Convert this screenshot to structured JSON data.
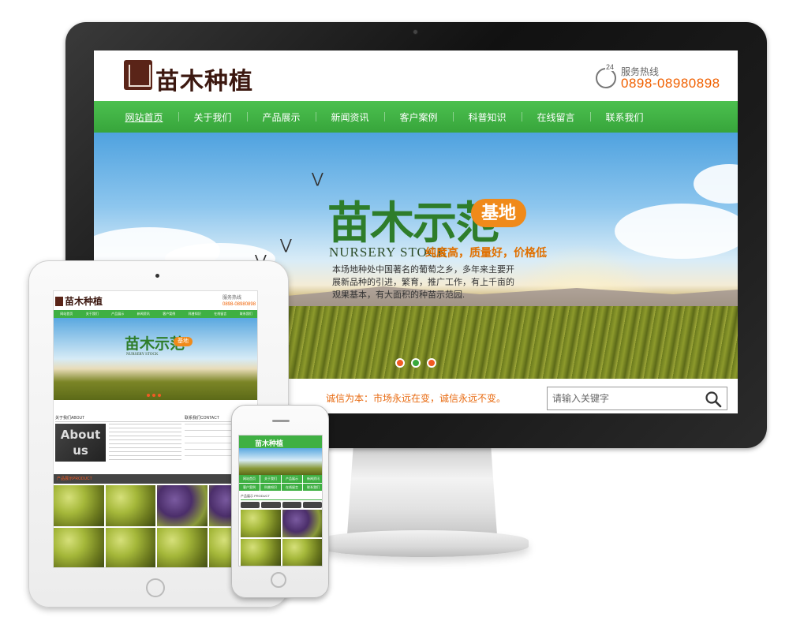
{
  "monitor": {
    "logo_text": "苗木种植",
    "hotline_label": "服务热线",
    "hotline_icon_text": "24",
    "hotline_number": "0898-08980898",
    "nav": [
      "网站首页",
      "关于我们",
      "产品展示",
      "新闻资讯",
      "客户案例",
      "科普知识",
      "在线留言",
      "联系我们"
    ],
    "banner": {
      "title": "苗木示范",
      "badge": "基地",
      "english": "NURSERY STOCK",
      "slogan": "纯度高，质量好，价格低",
      "description": "本场地种处中国著名的葡萄之乡，多年来主要开展新品种的引进，繁育，推广工作，有上千亩的观果基本，有大面积的种苗示范园.",
      "active_slide": 1,
      "slide_count": 3
    },
    "notice": "诚信为本：市场永远在变，诚信永远不变。",
    "search": {
      "placeholder": "请输入关键字"
    }
  },
  "tablet": {
    "logo_text": "苗木种植",
    "hotline_label": "服务热线",
    "hotline_number": "0898-08980898",
    "nav": [
      "网站首页",
      "关于我们",
      "产品展示",
      "新闻资讯",
      "客户案例",
      "科普知识",
      "在线留言",
      "联系我们"
    ],
    "banner_title": "苗木示范",
    "banner_badge": "基地",
    "banner_english": "NURSERY STOCK",
    "about_heading": "关于我们ABOUT",
    "contact_heading": "联系我们CONTACT",
    "about_image_text": "About us",
    "products_heading": "产品展示PRODUCT"
  },
  "phone": {
    "logo_text": "苗木种植",
    "nav": [
      "网站首页",
      "关于我们",
      "产品展示",
      "新闻资讯",
      "客户案例",
      "科普知识",
      "在线留言",
      "联系我们"
    ],
    "products_heading": "产品展示 PRODUCT"
  },
  "colors": {
    "nav_green": "#3fb043",
    "accent_orange": "#f06000",
    "logo_brown": "#3c1810"
  }
}
